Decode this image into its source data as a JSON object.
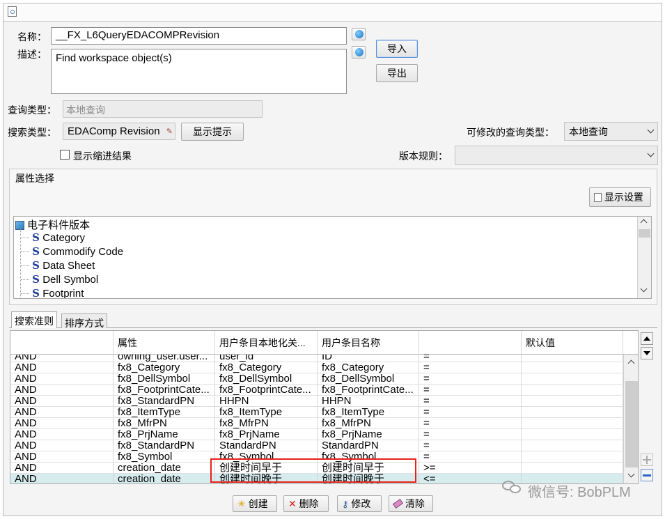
{
  "form": {
    "name_label": "名称：",
    "name_value": "__FX_L6QueryEDACOMPRevision",
    "desc_label": "描述：",
    "desc_value": "Find workspace object(s)",
    "import_label": "导入",
    "export_label": "导出",
    "query_type_label": "查询类型：",
    "query_type_value": "本地查询",
    "search_type_label": "搜索类型：",
    "search_type_value": "EDAComp Revision",
    "show_hint_label": "显示提示",
    "modifiable_query_type_label": "可修改的查询类型：",
    "modifiable_query_type_value": "本地查询",
    "indent_checkbox_label": "显示缩进结果",
    "revision_rule_label": "版本规则：",
    "revision_rule_value": ""
  },
  "attribute_selection": {
    "title": "属性选择",
    "display_settings_label": "显示设置",
    "root_label": "电子料件版本",
    "items": [
      "Category",
      "Commodify Code",
      "Data Sheet",
      "Dell Symbol",
      "Footprint"
    ]
  },
  "tabs": [
    {
      "label": "搜索准则",
      "active": true
    },
    {
      "label": "排序方式",
      "active": false
    }
  ],
  "criteria_table": {
    "headers": [
      "",
      "属性",
      "用户条目本地化关...",
      "用户条目名称",
      "",
      "默认值"
    ],
    "rows": [
      [
        "AND",
        "owning_user.user...",
        "user_id",
        "ID",
        "=",
        ""
      ],
      [
        "AND",
        "fx8_Category",
        "fx8_Category",
        "fx8_Category",
        "=",
        ""
      ],
      [
        "AND",
        "fx8_DellSymbol",
        "fx8_DellSymbol",
        "fx8_DellSymbol",
        "=",
        ""
      ],
      [
        "AND",
        "fx8_FootprintCate...",
        "fx8_FootprintCate...",
        "fx8_FootprintCate...",
        "=",
        ""
      ],
      [
        "AND",
        "fx8_StandardPN",
        "HHPN",
        "HHPN",
        "=",
        ""
      ],
      [
        "AND",
        "fx8_ItemType",
        "fx8_ItemType",
        "fx8_ItemType",
        "=",
        ""
      ],
      [
        "AND",
        "fx8_MfrPN",
        "fx8_MfrPN",
        "fx8_MfrPN",
        "=",
        ""
      ],
      [
        "AND",
        "fx8_PrjName",
        "fx8_PrjName",
        "fx8_PrjName",
        "=",
        ""
      ],
      [
        "AND",
        "fx8_StandardPN",
        "StandardPN",
        "StandardPN",
        "=",
        ""
      ],
      [
        "AND",
        "fx8_Symbol",
        "fx8_Symbol",
        "fx8_Symbol",
        "=",
        ""
      ],
      [
        "AND",
        "creation_date",
        "创建时间早于",
        "创建时间早于",
        ">=",
        ""
      ],
      [
        "AND",
        "creation_date",
        "创建时间晚于",
        "创建时间晚于",
        "<=",
        ""
      ]
    ],
    "selected_row_index": 11,
    "highlight_color": "#e8211a",
    "selected_row_color": "#d7ecee"
  },
  "actions": {
    "create": "创建",
    "delete": "删除",
    "modify": "修改",
    "clear": "清除"
  },
  "watermark": "微信号: BobPLM"
}
